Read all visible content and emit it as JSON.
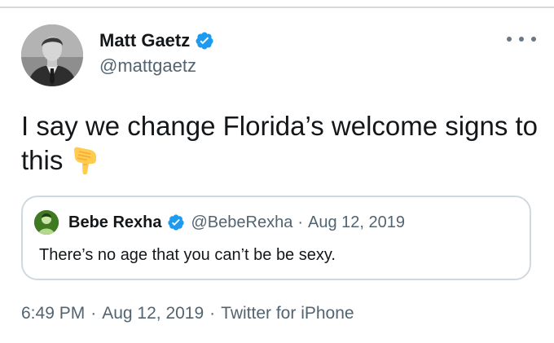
{
  "author": {
    "name": "Matt Gaetz",
    "handle": "@mattgaetz",
    "verified_icon": "verified-badge-icon"
  },
  "tweet": {
    "text": "I say we change Florida’s welcome signs to this",
    "emoji": "backhand-index-pointing-down-icon"
  },
  "quoted_tweet": {
    "name": "Bebe Rexha",
    "handle": "@BebeRexha",
    "separator": "·",
    "date": "Aug 12, 2019",
    "text": "There’s no age that you can’t be be sexy."
  },
  "meta": {
    "time": "6:49 PM",
    "separator": "·",
    "date": "Aug 12, 2019",
    "source": "Twitter for iPhone"
  },
  "colors": {
    "verified_blue": "#1d9bf0",
    "secondary_text": "#536471",
    "border": "#cfd9de"
  }
}
